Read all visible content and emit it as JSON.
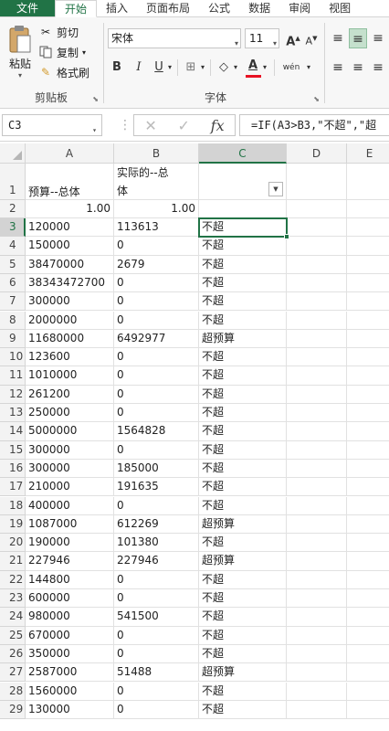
{
  "ribbon_tabs": [
    "文件",
    "开始",
    "插入",
    "页面布局",
    "公式",
    "数据",
    "审阅",
    "视图"
  ],
  "clipboard": {
    "paste": "粘贴",
    "cut": "剪切",
    "copy": "复制",
    "format_painter": "格式刷",
    "group_label": "剪贴板"
  },
  "font": {
    "name": "宋体",
    "size": "11",
    "bold": "B",
    "italic": "I",
    "underline": "U",
    "grow": "A",
    "shrink": "A",
    "font_color": "A",
    "phonetic": "wén",
    "group_label": "字体"
  },
  "formula_bar": {
    "name_box": "C3",
    "fx": "fx",
    "formula": "=IF(A3>B3,\"不超\",\"超"
  },
  "columns": [
    "A",
    "B",
    "C",
    "D",
    "E"
  ],
  "header_row": {
    "row": "1",
    "a": "预算--总体",
    "b1": "实际的--总",
    "b2": "体"
  },
  "row2": {
    "row": "2",
    "a": "1.00",
    "b": "1.00"
  },
  "rows": [
    {
      "row": "3",
      "a": "120000",
      "b": "113613",
      "c": "不超"
    },
    {
      "row": "4",
      "a": "150000",
      "b": "0",
      "c": "不超"
    },
    {
      "row": "5",
      "a": "38470000",
      "b": "2679",
      "c": "不超"
    },
    {
      "row": "6",
      "a": "38343472700",
      "b": "0",
      "c": "不超"
    },
    {
      "row": "7",
      "a": "300000",
      "b": "0",
      "c": "不超"
    },
    {
      "row": "8",
      "a": "2000000",
      "b": "0",
      "c": "不超"
    },
    {
      "row": "9",
      "a": "11680000",
      "b": "6492977",
      "c": "超预算"
    },
    {
      "row": "10",
      "a": "123600",
      "b": "0",
      "c": "不超"
    },
    {
      "row": "11",
      "a": "1010000",
      "b": "0",
      "c": "不超"
    },
    {
      "row": "12",
      "a": "261200",
      "b": "0",
      "c": "不超"
    },
    {
      "row": "13",
      "a": "250000",
      "b": "0",
      "c": "不超"
    },
    {
      "row": "14",
      "a": "5000000",
      "b": "1564828",
      "c": "不超"
    },
    {
      "row": "15",
      "a": "300000",
      "b": "0",
      "c": "不超"
    },
    {
      "row": "16",
      "a": "300000",
      "b": "185000",
      "c": "不超"
    },
    {
      "row": "17",
      "a": "210000",
      "b": "191635",
      "c": "不超"
    },
    {
      "row": "18",
      "a": "400000",
      "b": "0",
      "c": "不超"
    },
    {
      "row": "19",
      "a": "1087000",
      "b": "612269",
      "c": "超预算"
    },
    {
      "row": "20",
      "a": "190000",
      "b": "101380",
      "c": "不超"
    },
    {
      "row": "21",
      "a": "227946",
      "b": "227946",
      "c": "超预算"
    },
    {
      "row": "22",
      "a": "144800",
      "b": "0",
      "c": "不超"
    },
    {
      "row": "23",
      "a": "600000",
      "b": "0",
      "c": "不超"
    },
    {
      "row": "24",
      "a": "980000",
      "b": "541500",
      "c": "不超"
    },
    {
      "row": "25",
      "a": "670000",
      "b": "0",
      "c": "不超"
    },
    {
      "row": "26",
      "a": "350000",
      "b": "0",
      "c": "不超"
    },
    {
      "row": "27",
      "a": "2587000",
      "b": "51488",
      "c": "超预算"
    },
    {
      "row": "28",
      "a": "1560000",
      "b": "0",
      "c": "不超"
    },
    {
      "row": "29",
      "a": "130000",
      "b": "0",
      "c": "不超"
    }
  ],
  "colors": {
    "accent": "#217346",
    "font_color_bar": "#e81123"
  }
}
